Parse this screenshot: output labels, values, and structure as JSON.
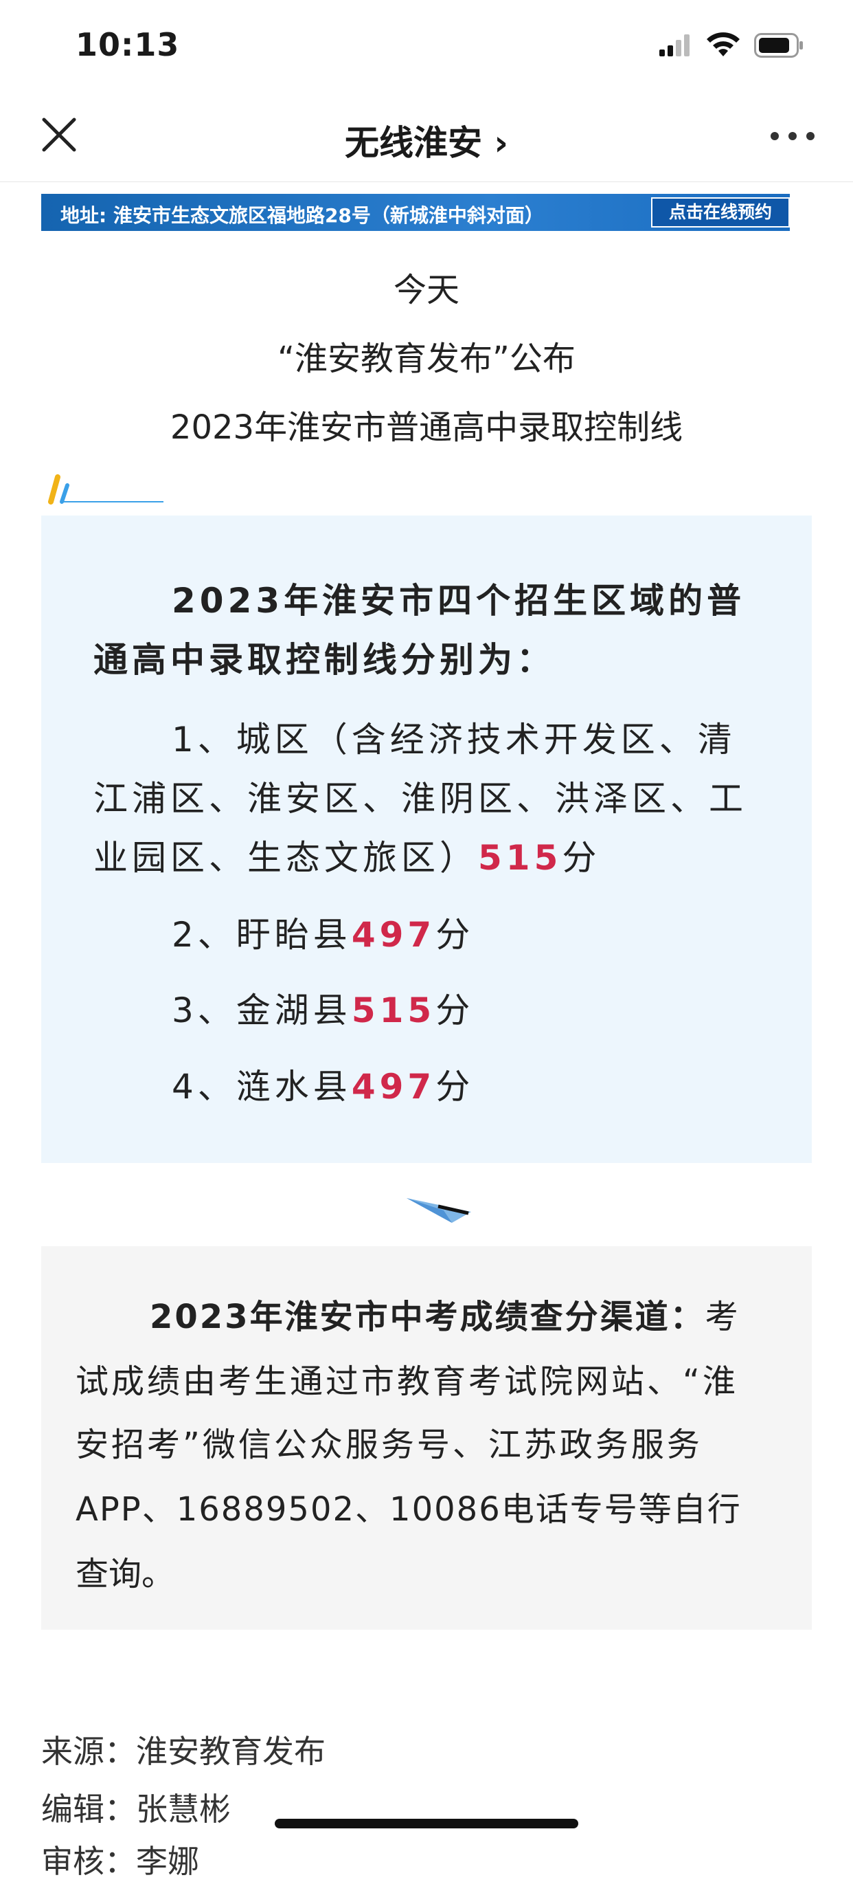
{
  "status_bar": {
    "time": "10:13"
  },
  "nav": {
    "title": "无线淮安 ›",
    "close_icon": "close-icon",
    "more_icon": "more-dots-icon"
  },
  "banner": {
    "address": "地址: 淮安市生态文旅区福地路28号（新城淮中斜对面）",
    "button": "点击在线预约"
  },
  "intro": {
    "line1": "今天",
    "line2": "“淮安教育发布”公布",
    "line3": "2023年淮安市普通高中录取控制线"
  },
  "scores": {
    "heading_line1": "2023年淮安市四个招生区域的普",
    "heading_line2": "通高中录取控制线分别为：",
    "item1_line1": "1、城区（含经济技术开发区、清",
    "item1_line2": "江浦区、淮安区、淮阴区、洪泽区、工",
    "item1_line3_text": "业园区、生态文旅区）",
    "item1_score": "515",
    "unit": "分",
    "item2_label": "2、盱眙县",
    "item2_score": "497",
    "item3_label": "3、金湖县",
    "item3_score": "515",
    "item4_label": "4、涟水县",
    "item4_score": "497"
  },
  "query": {
    "line1_bold": "2023年淮安市中考成绩查分渠道：",
    "line1_rest": "考",
    "line2": "试成绩由考生通过市教育考试院网站、“淮",
    "line3": "安招考”微信公众服务号、江苏政务服务",
    "line4": "APP、16889502、10086电话专号等自行",
    "line5": "查询。"
  },
  "footer": {
    "source": "来源：淮安教育发布",
    "editor": "编辑：张慧彬",
    "reviewer": "审核：李娜"
  },
  "colors": {
    "accent_red": "#d0284a",
    "banner_blue": "#1a6cc0",
    "score_box_bg": "#edf6fd",
    "query_box_bg": "#f5f5f5"
  }
}
